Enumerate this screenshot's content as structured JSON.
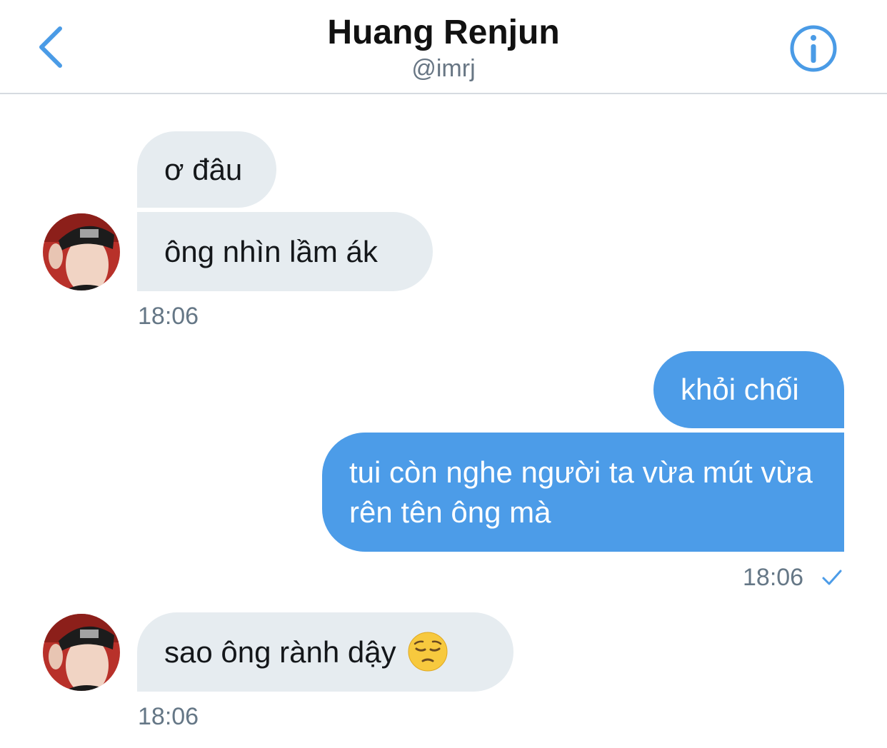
{
  "header": {
    "title": "Huang Renjun",
    "handle": "@imrj",
    "back_icon": "chevron-left-icon",
    "info_icon": "info-circle-icon"
  },
  "messages": [
    {
      "direction": "incoming",
      "text": "ơ đâu"
    },
    {
      "direction": "incoming",
      "text": "ông nhìn lầm ák"
    },
    {
      "direction": "outgoing",
      "text": "khỏi chối"
    },
    {
      "direction": "outgoing",
      "text": "tui còn nghe người ta vừa mút vừa rên tên ông mà"
    },
    {
      "direction": "incoming",
      "text": "sao ông rành dậy",
      "emoji": "pensive-face-emoji"
    }
  ],
  "timestamps": {
    "group1": "18:06",
    "group2": "18:06",
    "group3": "18:06"
  },
  "colors": {
    "accent": "#4c9ce8",
    "incoming_bubble": "#e6ecf0",
    "muted_text": "#657786"
  }
}
